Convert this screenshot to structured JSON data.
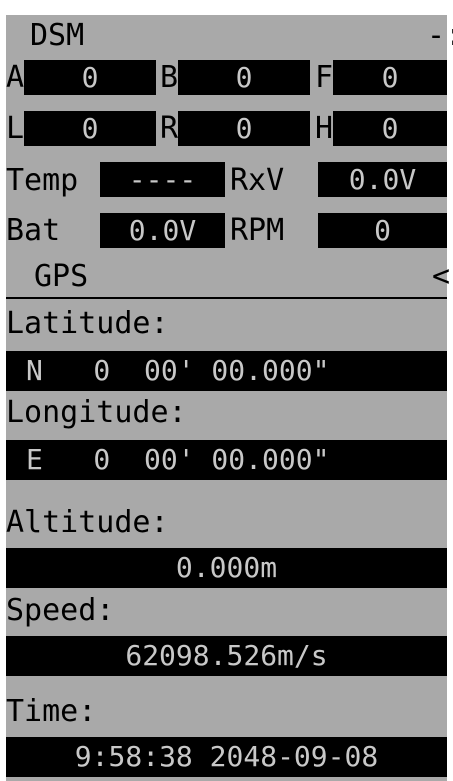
{
  "header": {
    "title": "DSM",
    "edge_glyph": "-:"
  },
  "telemetry": {
    "row1": [
      {
        "label": "A",
        "value": "0"
      },
      {
        "label": "B",
        "value": "0"
      },
      {
        "label": "F",
        "value": "0"
      }
    ],
    "row2": [
      {
        "label": "L",
        "value": "0"
      },
      {
        "label": "R",
        "value": "0"
      },
      {
        "label": "H",
        "value": "0"
      }
    ],
    "temp_label": "Temp",
    "temp_value": "----",
    "rxv_label": "RxV",
    "rxv_value": "0.0V",
    "bat_label": "Bat",
    "bat_value": "0.0V",
    "rpm_label": "RPM",
    "rpm_value": "0"
  },
  "gps": {
    "section_title": "GPS",
    "collapse_glyph": "<",
    "latitude_label": "Latitude:",
    "latitude_value": "N   0  00' 00.000\"",
    "longitude_label": "Longitude:",
    "longitude_value": "E   0  00' 00.000\"",
    "altitude_label": "Altitude:",
    "altitude_value": "0.000m",
    "speed_label": "Speed:",
    "speed_value": "62098.526m/s",
    "time_label": "Time:",
    "time_value": "9:58:38 2048-09-08"
  },
  "colors": {
    "screen_bg": "#a9a9a9",
    "box_bg": "#000000",
    "box_text": "#c8c8c8",
    "label_text": "#000000"
  }
}
